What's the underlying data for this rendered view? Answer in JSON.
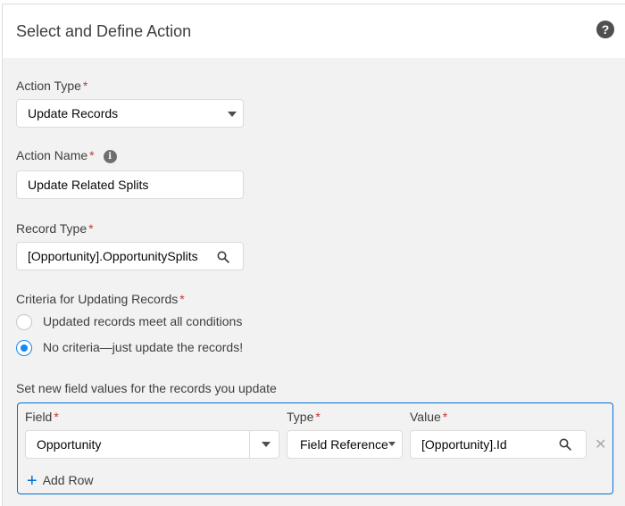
{
  "header": {
    "title": "Select and Define Action",
    "help_icon": "question-circle-icon",
    "help_glyph": "?"
  },
  "action_type": {
    "label": "Action Type",
    "required_mark": "*",
    "value": "Update Records"
  },
  "action_name": {
    "label": "Action Name",
    "required_mark": "*",
    "info_glyph": "i",
    "value": "Update Related Splits"
  },
  "record_type": {
    "label": "Record Type",
    "required_mark": "*",
    "value": "[Opportunity].OpportunitySplits"
  },
  "criteria": {
    "label": "Criteria for Updating Records",
    "required_mark": "*",
    "options": [
      {
        "label": "Updated records meet all conditions",
        "selected": false
      },
      {
        "label": "No criteria—just update the records!",
        "selected": true
      }
    ]
  },
  "field_values": {
    "label": "Set new field values for the records you update",
    "columns": {
      "field": "Field",
      "type": "Type",
      "value": "Value",
      "required_mark": "*"
    },
    "rows": [
      {
        "field": "Opportunity",
        "type": "Field Reference",
        "value": "[Opportunity].Id"
      }
    ],
    "remove_glyph": "✕",
    "add_row_glyph": "+",
    "add_row_label": "Add Row"
  },
  "colors": {
    "accent": "#0070d2",
    "required": "#c23934",
    "radio_selected": "#1589ee"
  }
}
